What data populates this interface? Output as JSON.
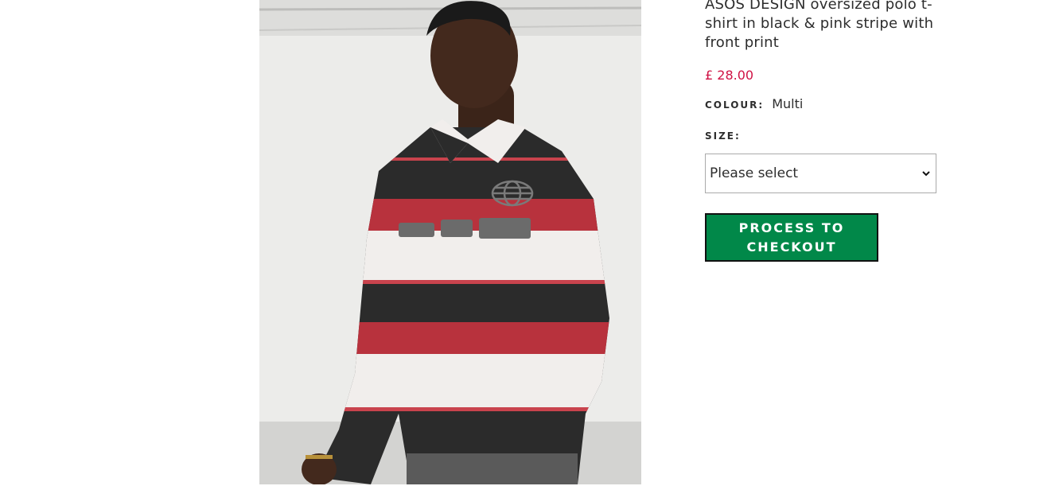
{
  "product": {
    "title": "ASOS DESIGN oversized polo t-shirt in black & pink stripe with front print",
    "price": "£ 28.00",
    "image_alt": "Model wearing oversized polo t-shirt in black, red and white stripes with front print"
  },
  "colour": {
    "label": "COLOUR:",
    "value": "Multi"
  },
  "size": {
    "label": "SIZE:",
    "selected": "Please select"
  },
  "checkout": {
    "label": "PROCESS TO CHECKOUT"
  },
  "colors": {
    "price": "#d01345",
    "checkout_bg": "#018849",
    "text": "#2d2d2d"
  },
  "icons": {
    "select": "chevron-down-icon",
    "print": "globe-icon"
  }
}
